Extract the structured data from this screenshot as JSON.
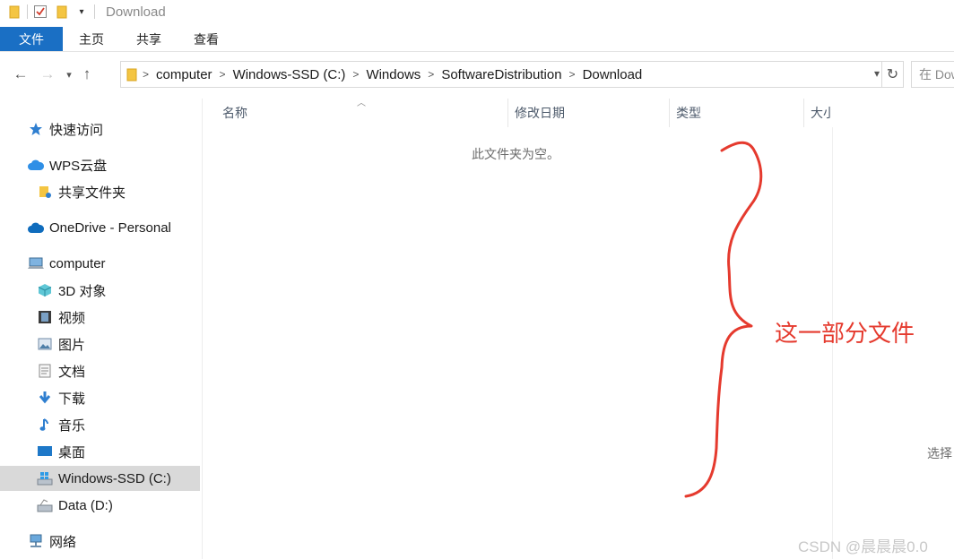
{
  "window": {
    "title": "Download"
  },
  "ribbon": {
    "tabs": [
      "文件",
      "主页",
      "共享",
      "查看"
    ]
  },
  "address": {
    "breadcrumbs": [
      "computer",
      "Windows-SSD (C:)",
      "Windows",
      "SoftwareDistribution",
      "Download"
    ],
    "search_placeholder": "在 Download 中搜索"
  },
  "sidebar": {
    "items": [
      {
        "label": "快速访问",
        "icon": "star-icon"
      },
      {
        "label": "WPS云盘",
        "icon": "cloud-icon"
      },
      {
        "label": "共享文件夹",
        "icon": "shared-folder-icon"
      },
      {
        "label": "OneDrive - Personal",
        "icon": "onedrive-icon"
      },
      {
        "label": "computer",
        "icon": "computer-icon"
      },
      {
        "label": "3D 对象",
        "icon": "3d-objects-icon"
      },
      {
        "label": "视频",
        "icon": "video-icon"
      },
      {
        "label": "图片",
        "icon": "pictures-icon"
      },
      {
        "label": "文档",
        "icon": "documents-icon"
      },
      {
        "label": "下载",
        "icon": "download-icon"
      },
      {
        "label": "音乐",
        "icon": "music-icon"
      },
      {
        "label": "桌面",
        "icon": "desktop-icon"
      },
      {
        "label": "Windows-SSD (C:)",
        "icon": "windows-drive-icon",
        "selected": true
      },
      {
        "label": "Data (D:)",
        "icon": "drive-icon"
      },
      {
        "label": "网络",
        "icon": "network-icon"
      }
    ]
  },
  "columns": [
    "名称",
    "修改日期",
    "类型",
    "大小"
  ],
  "content": {
    "empty_message": "此文件夹为空。"
  },
  "preview_pane": {
    "text": "选择"
  },
  "annotation": {
    "text": "这一部分文件",
    "color": "#e53a2e"
  },
  "watermark": "CSDN @晨晨晨0.0",
  "colors": {
    "accent": "#1a6fc4",
    "selected_bg": "#d9d9d9"
  }
}
